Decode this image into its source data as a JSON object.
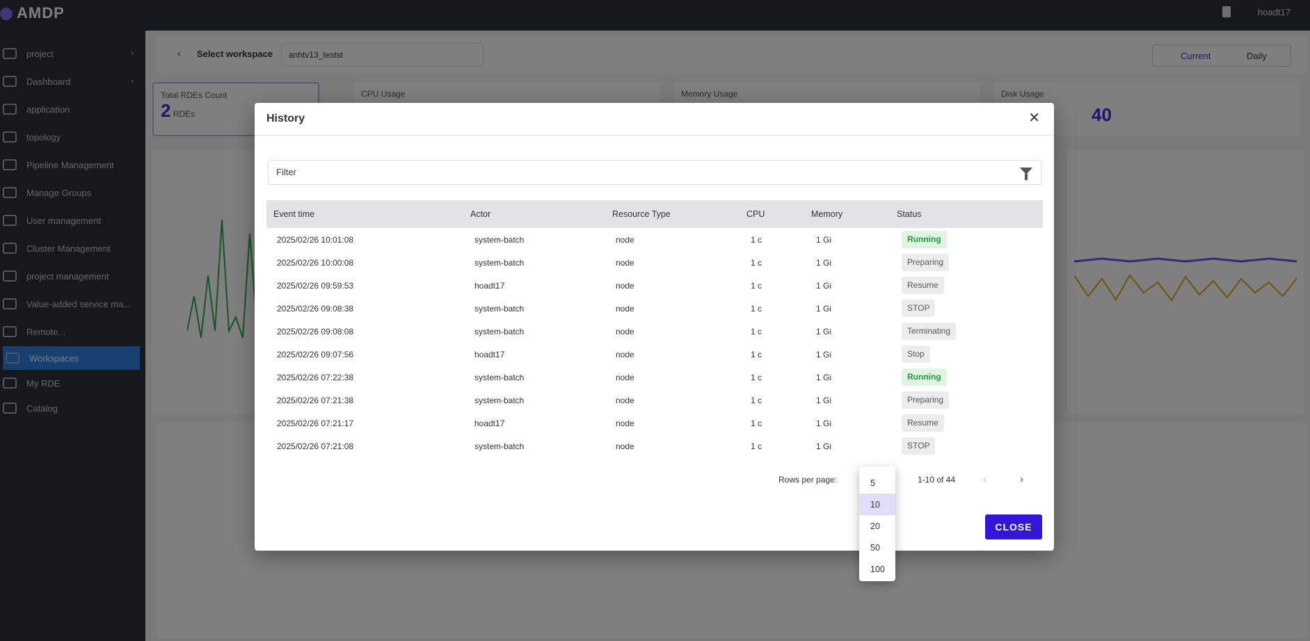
{
  "app": {
    "name": "AMDP",
    "user": "hoadt17"
  },
  "sidebar": {
    "items": [
      {
        "label": "project",
        "icon": "folder-icon"
      },
      {
        "label": "Dashboard",
        "icon": "dashboard-icon"
      },
      {
        "label": "application",
        "icon": "gear-icon"
      },
      {
        "label": "topology",
        "icon": "triangle-icon"
      },
      {
        "label": "Pipeline Management",
        "icon": "pipeline-icon"
      },
      {
        "label": "Manage Groups",
        "icon": "group-icon"
      },
      {
        "label": "User management",
        "icon": "user-icon"
      },
      {
        "label": "Cluster Management",
        "icon": "cluster-icon"
      },
      {
        "label": "project management",
        "icon": "folder-icon"
      },
      {
        "label": "Value-added service ma...",
        "icon": "service-icon"
      },
      {
        "label": "Remote...",
        "icon": "remote-icon"
      },
      {
        "label": "Workspaces",
        "icon": "workspace-icon"
      },
      {
        "label": "My RDE",
        "icon": "rde-icon"
      },
      {
        "label": "Catalog",
        "icon": "catalog-icon"
      }
    ]
  },
  "workspace": {
    "label": "Select workspace",
    "value": "anhtv13_testst",
    "toggle": [
      "Current",
      "Daily"
    ]
  },
  "cards": {
    "rde_title": "Total RDEs Count",
    "rde_value": "2",
    "rde_unit": "RDEs",
    "cpu": "CPU Usage",
    "memory": "Memory Usage",
    "disk": "Disk Usage",
    "disk_value": "40"
  },
  "modal": {
    "title": "History",
    "filter_placeholder": "Filter",
    "columns": [
      "Event time",
      "Actor",
      "Resource Type",
      "CPU",
      "Memory",
      "Status"
    ],
    "rows": [
      {
        "time": "2025/02/26 10:01:08",
        "actor": "system-batch",
        "type": "node",
        "cpu": "1 c",
        "memory": "1 Gi",
        "status": "Running"
      },
      {
        "time": "2025/02/26 10:00:08",
        "actor": "system-batch",
        "type": "node",
        "cpu": "1 c",
        "memory": "1 Gi",
        "status": "Preparing"
      },
      {
        "time": "2025/02/26 09:59:53",
        "actor": "hoadt17",
        "type": "node",
        "cpu": "1 c",
        "memory": "1 Gi",
        "status": "Resume"
      },
      {
        "time": "2025/02/26 09:08:38",
        "actor": "system-batch",
        "type": "node",
        "cpu": "1 c",
        "memory": "1 Gi",
        "status": "STOP"
      },
      {
        "time": "2025/02/26 09:08:08",
        "actor": "system-batch",
        "type": "node",
        "cpu": "1 c",
        "memory": "1 Gi",
        "status": "Terminating"
      },
      {
        "time": "2025/02/26 09:07:56",
        "actor": "hoadt17",
        "type": "node",
        "cpu": "1 c",
        "memory": "1 Gi",
        "status": "Stop"
      },
      {
        "time": "2025/02/26 07:22:38",
        "actor": "system-batch",
        "type": "node",
        "cpu": "1 c",
        "memory": "1 Gi",
        "status": "Running"
      },
      {
        "time": "2025/02/26 07:21:38",
        "actor": "system-batch",
        "type": "node",
        "cpu": "1 c",
        "memory": "1 Gi",
        "status": "Preparing"
      },
      {
        "time": "2025/02/26 07:21:17",
        "actor": "hoadt17",
        "type": "node",
        "cpu": "1 c",
        "memory": "1 Gi",
        "status": "Resume"
      },
      {
        "time": "2025/02/26 07:21:08",
        "actor": "system-batch",
        "type": "node",
        "cpu": "1 c",
        "memory": "1 Gi",
        "status": "STOP"
      }
    ],
    "rows_per_page_label": "Rows per page:",
    "range": "1-10 of 44",
    "rows_per_page_options": [
      "5",
      "10",
      "20",
      "50",
      "100"
    ],
    "rows_per_page_selected": "10",
    "close_label": "CLOSE"
  },
  "colors": {
    "accent": "#3317d6",
    "running": "#1f9d3c",
    "sidebar_active": "#2f7fe0"
  }
}
